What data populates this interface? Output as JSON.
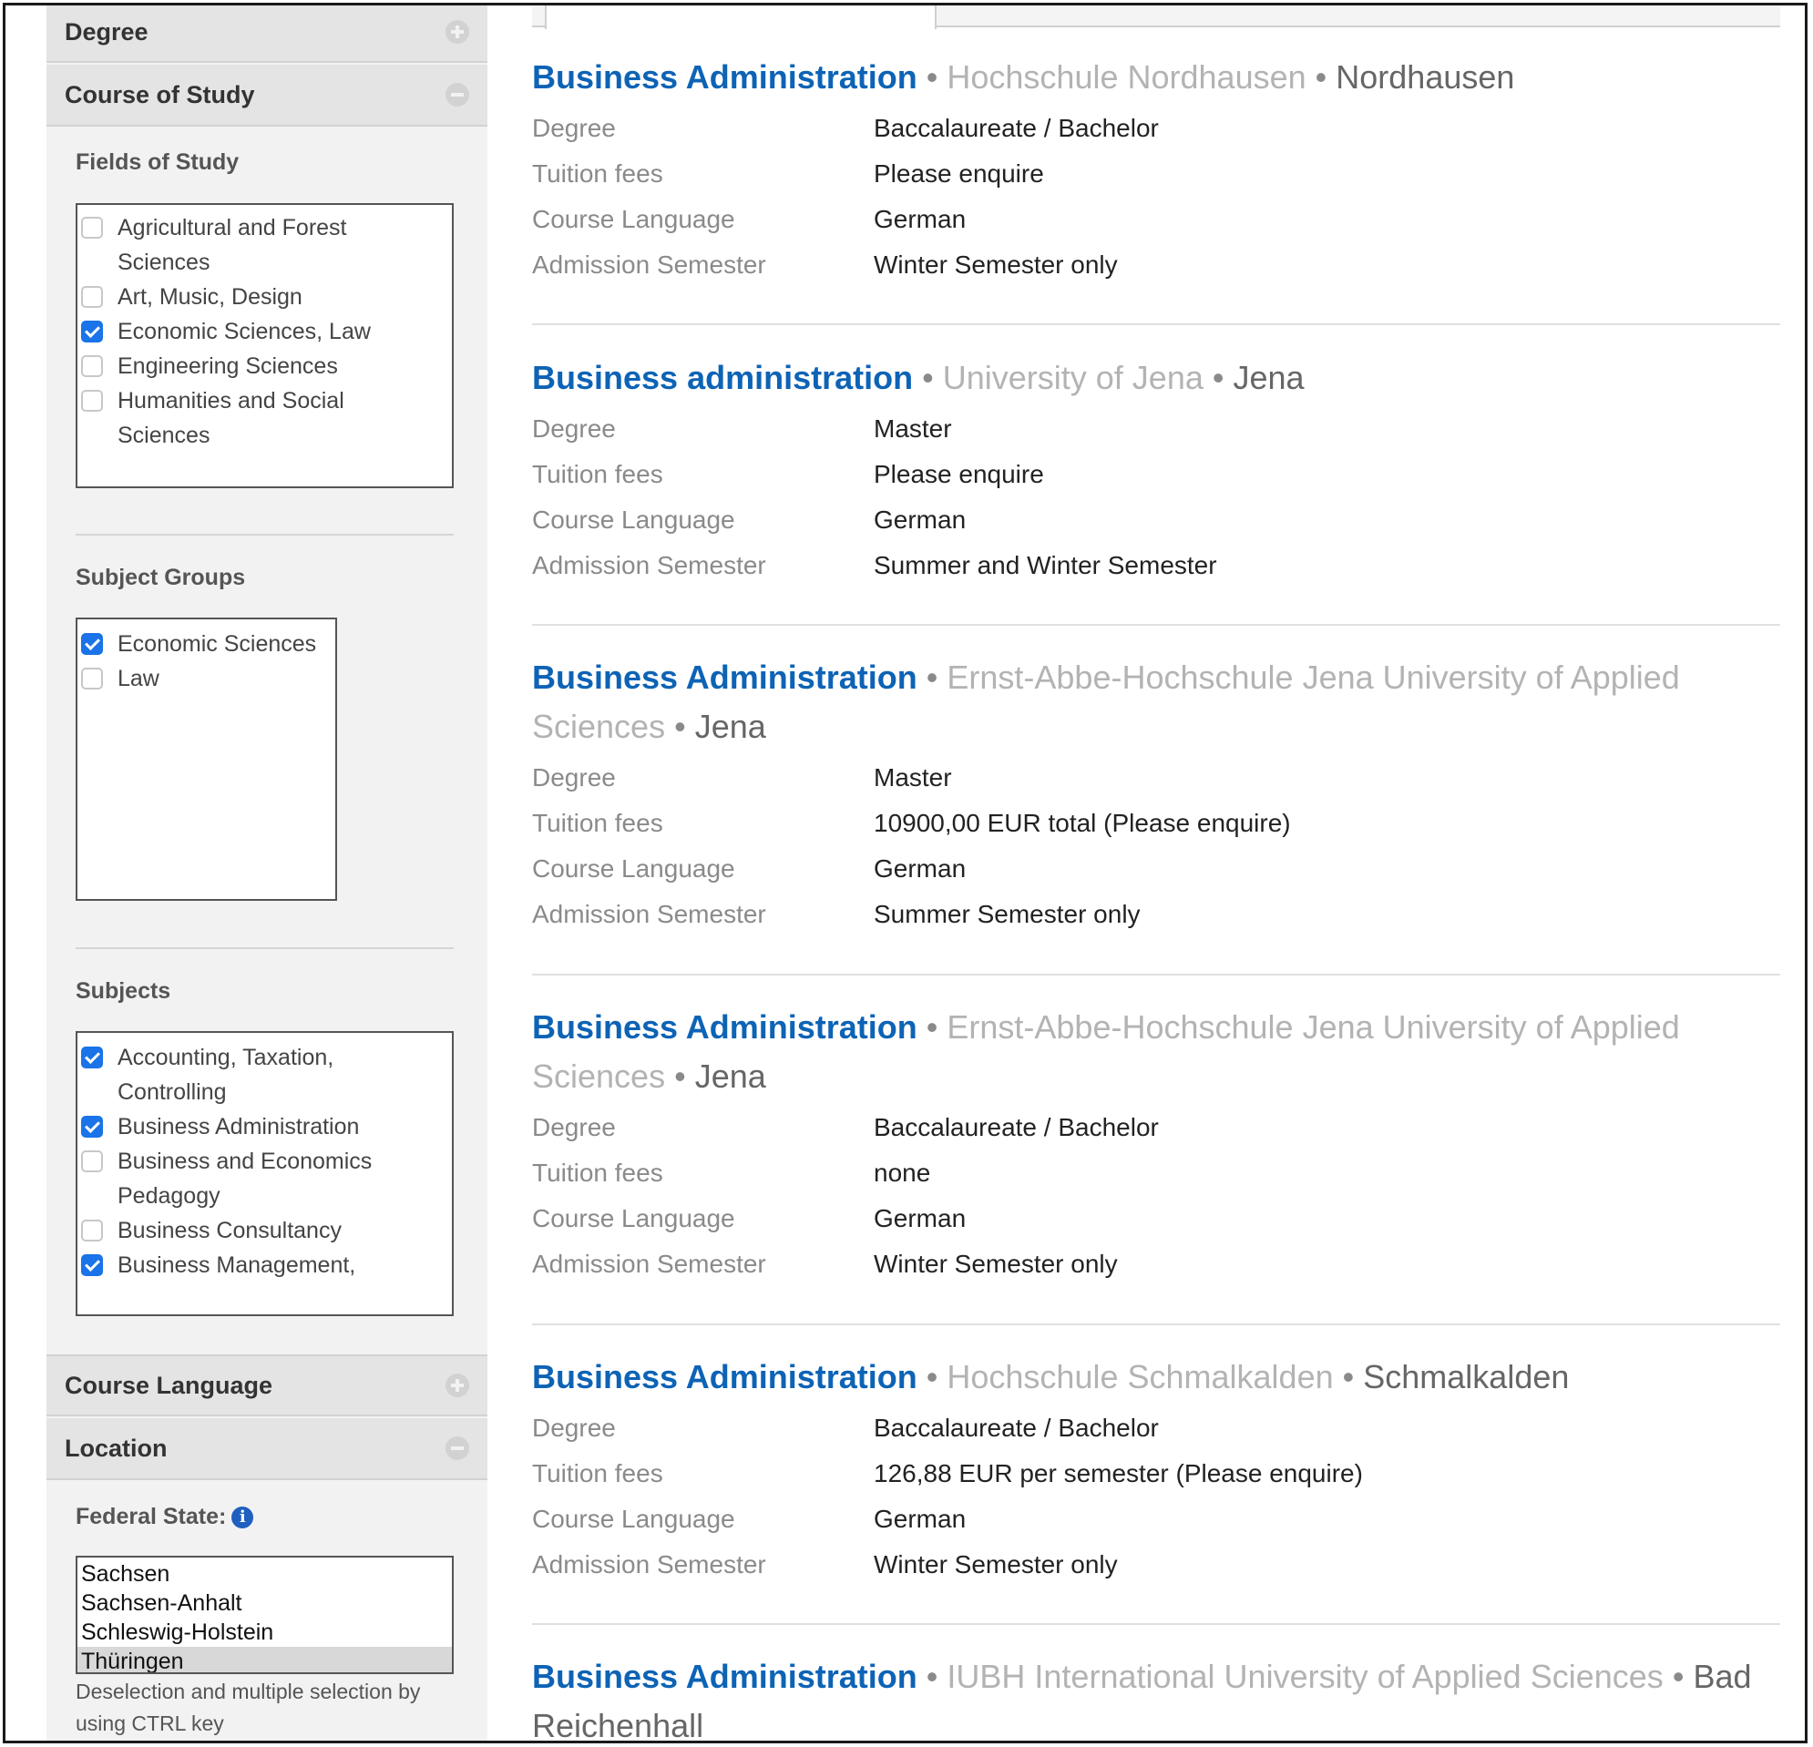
{
  "sidebar": {
    "sections": {
      "degree": "Degree",
      "course_of_study": "Course of Study",
      "course_language": "Course Language",
      "location": "Location"
    },
    "fields_of_study": {
      "title": "Fields of Study",
      "items": [
        {
          "label": "Agricultural and Forest Sciences",
          "checked": false
        },
        {
          "label": "Art, Music, Design",
          "checked": false
        },
        {
          "label": "Economic Sciences, Law",
          "checked": true
        },
        {
          "label": "Engineering Sciences",
          "checked": false
        },
        {
          "label": "Humanities and Social Sciences",
          "checked": false
        }
      ]
    },
    "subject_groups": {
      "title": "Subject Groups",
      "items": [
        {
          "label": "Economic Sciences",
          "checked": true
        },
        {
          "label": "Law",
          "checked": false
        }
      ]
    },
    "subjects": {
      "title": "Subjects",
      "items": [
        {
          "label": "Accounting, Taxation, Controlling",
          "checked": true
        },
        {
          "label": "Business Administration",
          "checked": true
        },
        {
          "label": "Business and Economics Pedagogy",
          "checked": false
        },
        {
          "label": "Business Consultancy",
          "checked": false
        },
        {
          "label": "Business Management,",
          "checked": true
        }
      ]
    },
    "federal_state": {
      "label": "Federal State:",
      "info_icon": "info-icon",
      "options": [
        "Sachsen",
        "Sachsen-Anhalt",
        "Schleswig-Holstein",
        "Thüringen"
      ],
      "selected": "Thüringen",
      "hint": "Deselection and multiple selection by using CTRL key"
    }
  },
  "labels": {
    "degree": "Degree",
    "tuition": "Tuition fees",
    "language": "Course Language",
    "semester": "Admission Semester",
    "bullet": "•"
  },
  "results": [
    {
      "course": "Business Administration",
      "university": "Hochschule Nordhausen",
      "city": "Nordhausen",
      "degree": "Baccalaureate / Bachelor",
      "tuition": "Please enquire",
      "language": "German",
      "semester": "Winter Semester only"
    },
    {
      "course": "Business administration",
      "university": "University of Jena",
      "city": "Jena",
      "degree": "Master",
      "tuition": "Please enquire",
      "language": "German",
      "semester": "Summer and Winter Semester"
    },
    {
      "course": "Business Administration",
      "university": "Ernst-Abbe-Hochschule Jena University of Applied Sciences",
      "city": "Jena",
      "degree": "Master",
      "tuition": "10900,00 EUR total (Please enquire)",
      "language": "German",
      "semester": "Summer Semester only"
    },
    {
      "course": "Business Administration",
      "university": "Ernst-Abbe-Hochschule Jena University of Applied Sciences",
      "city": "Jena",
      "degree": "Baccalaureate / Bachelor",
      "tuition": "none",
      "language": "German",
      "semester": "Winter Semester only"
    },
    {
      "course": "Business Administration",
      "university": "Hochschule Schmalkalden",
      "city": "Schmalkalden",
      "degree": "Baccalaureate / Bachelor",
      "tuition": "126,88 EUR per semester (Please enquire)",
      "language": "German",
      "semester": "Winter Semester only"
    },
    {
      "course": "Business Administration",
      "university": "IUBH International University of Applied Sciences",
      "city": "Bad Reichenhall"
    }
  ]
}
